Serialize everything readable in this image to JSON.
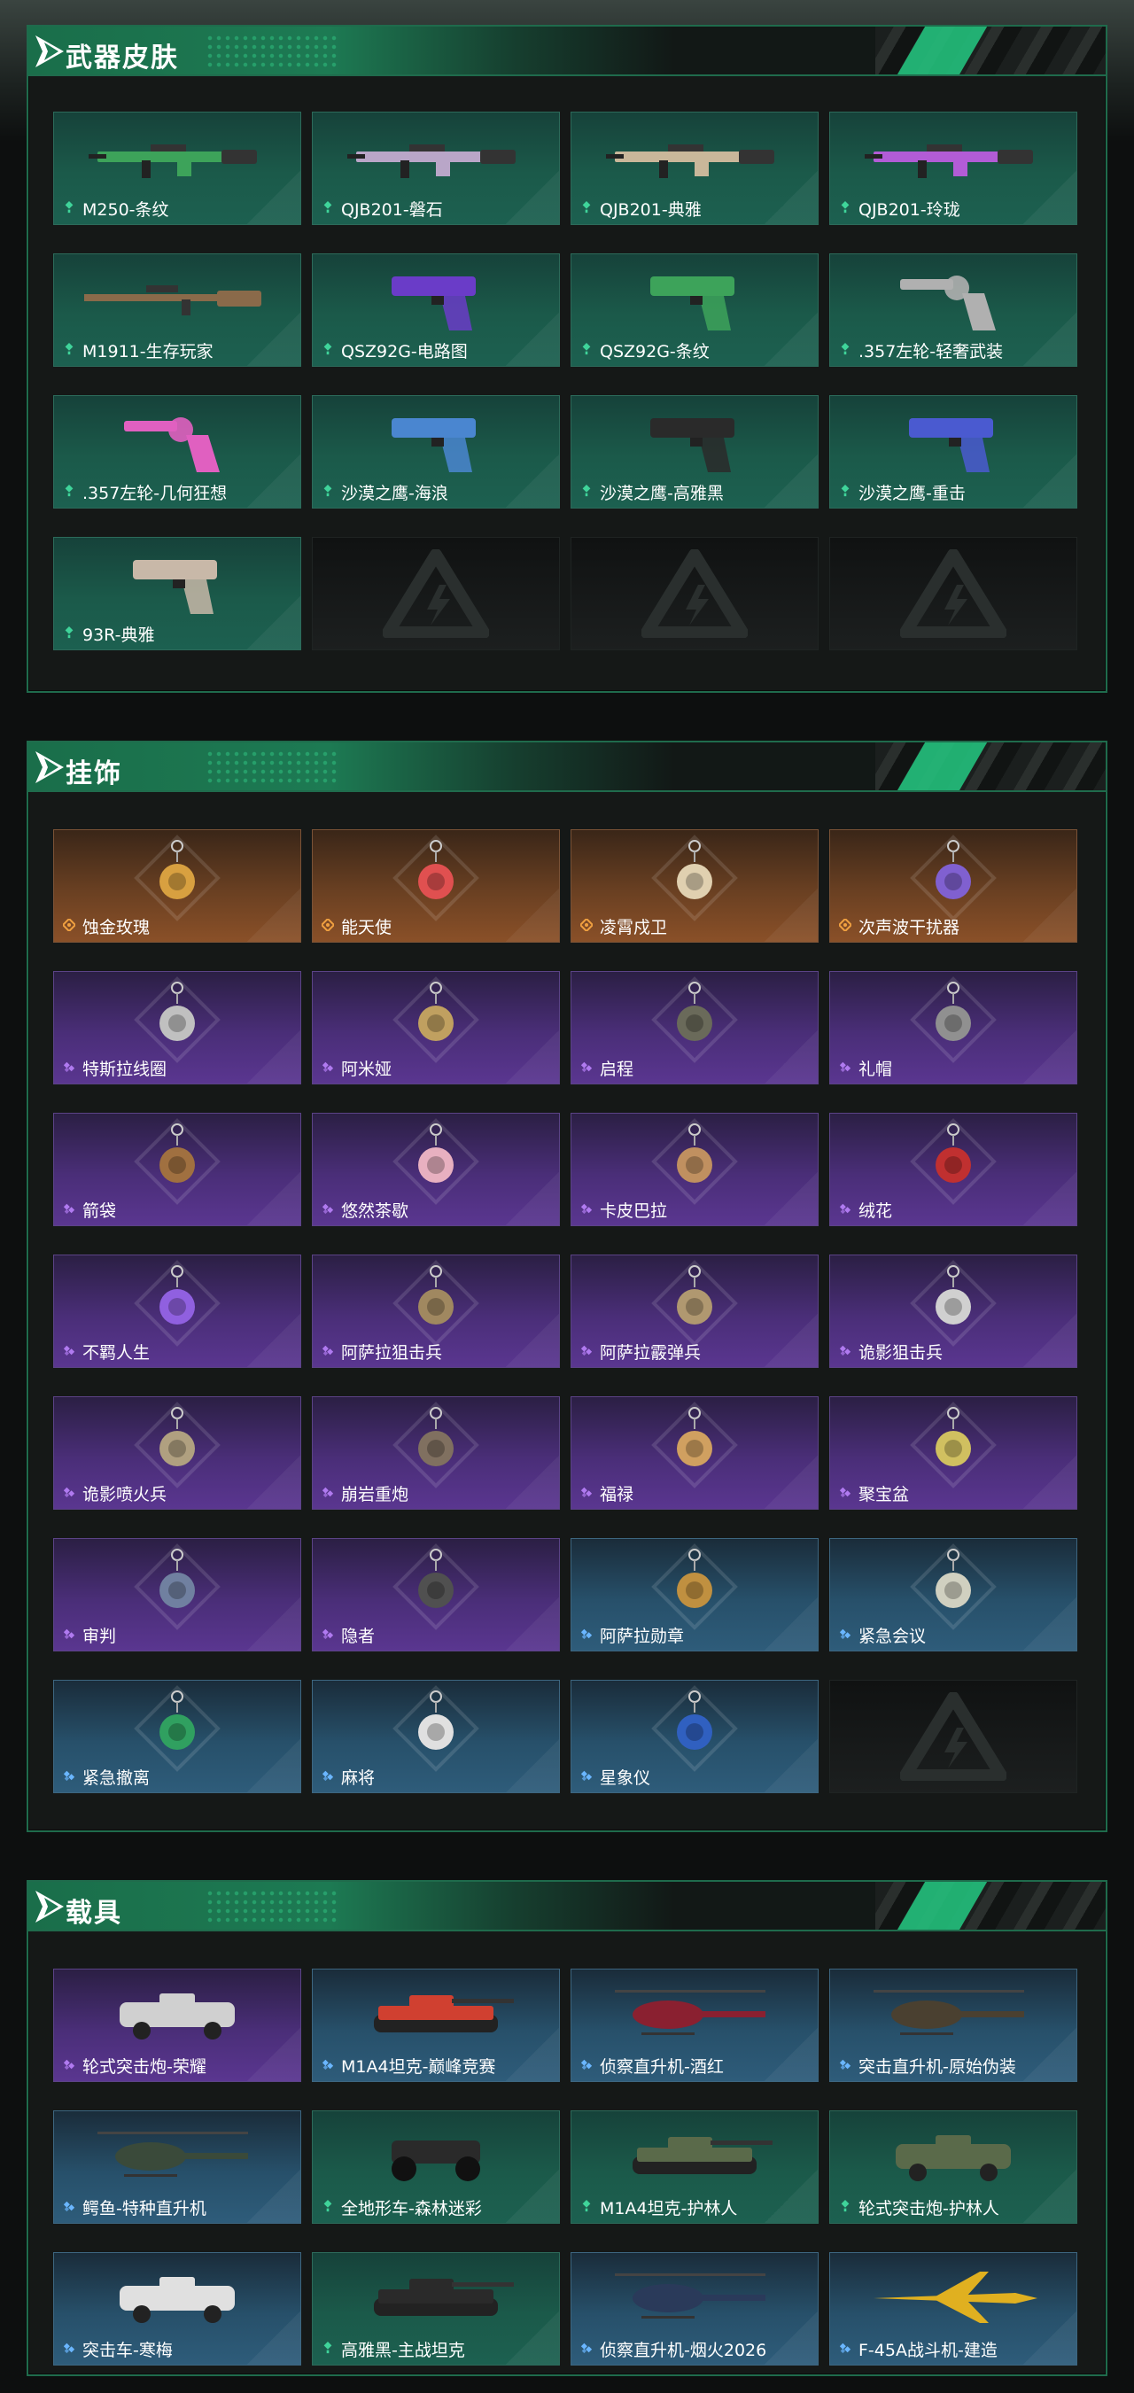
{
  "sections": [
    {
      "title": "武器皮肤",
      "items": [
        {
          "name": "M250-条纹",
          "rarity": "green",
          "icon": "rifle-icon",
          "color": "#3da35a"
        },
        {
          "name": "QJB201-磐石",
          "rarity": "green",
          "icon": "rifle-icon",
          "color": "#b9a6c8"
        },
        {
          "name": "QJB201-典雅",
          "rarity": "green",
          "icon": "rifle-icon",
          "color": "#c9b79a"
        },
        {
          "name": "QJB201-玲珑",
          "rarity": "green",
          "icon": "rifle-icon",
          "color": "#b25cd6"
        },
        {
          "name": "M1911-生存玩家",
          "rarity": "green",
          "icon": "sniper-icon",
          "color": "#8a6a4a"
        },
        {
          "name": "QSZ92G-电路图",
          "rarity": "green",
          "icon": "pistol-icon",
          "color": "#6a3cc8"
        },
        {
          "name": "QSZ92G-条纹",
          "rarity": "green",
          "icon": "pistol-icon",
          "color": "#3da35a"
        },
        {
          "name": ".357左轮-轻奢武装",
          "rarity": "green",
          "icon": "revolver-icon",
          "color": "#b0b0b0"
        },
        {
          "name": ".357左轮-几何狂想",
          "rarity": "green",
          "icon": "revolver-icon",
          "color": "#e060c0"
        },
        {
          "name": "沙漠之鹰-海浪",
          "rarity": "green",
          "icon": "pistol-icon",
          "color": "#4a86d0"
        },
        {
          "name": "沙漠之鹰-高雅黑",
          "rarity": "green",
          "icon": "pistol-icon",
          "color": "#2a2a2a"
        },
        {
          "name": "沙漠之鹰-重击",
          "rarity": "green",
          "icon": "pistol-icon",
          "color": "#4a5ad0"
        },
        {
          "name": "93R-典雅",
          "rarity": "green",
          "icon": "pistol-icon",
          "color": "#c8b8a8"
        },
        {
          "name": "",
          "rarity": "empty"
        },
        {
          "name": "",
          "rarity": "empty"
        },
        {
          "name": "",
          "rarity": "empty"
        }
      ]
    },
    {
      "title": "挂饰",
      "items": [
        {
          "name": "蚀金玫瑰",
          "rarity": "orange",
          "icon": "charm-icon",
          "color": "#d8a040"
        },
        {
          "name": "能天使",
          "rarity": "orange",
          "icon": "charm-icon",
          "color": "#e05050"
        },
        {
          "name": "凌霄戍卫",
          "rarity": "orange",
          "icon": "charm-icon",
          "color": "#e0d0b0"
        },
        {
          "name": "次声波干扰器",
          "rarity": "orange",
          "icon": "charm-icon",
          "color": "#8060d0"
        },
        {
          "name": "特斯拉线圈",
          "rarity": "purple",
          "icon": "charm-icon",
          "color": "#c0c0c0"
        },
        {
          "name": "阿米娅",
          "rarity": "purple",
          "icon": "charm-icon",
          "color": "#c0a060"
        },
        {
          "name": "启程",
          "rarity": "purple",
          "icon": "charm-icon",
          "color": "#6a6a5a"
        },
        {
          "name": "礼帽",
          "rarity": "purple",
          "icon": "charm-icon",
          "color": "#909090"
        },
        {
          "name": "箭袋",
          "rarity": "purple",
          "icon": "charm-icon",
          "color": "#a07040"
        },
        {
          "name": "悠然茶歇",
          "rarity": "purple",
          "icon": "charm-icon",
          "color": "#e8b0c0"
        },
        {
          "name": "卡皮巴拉",
          "rarity": "purple",
          "icon": "charm-icon",
          "color": "#c09060"
        },
        {
          "name": "绒花",
          "rarity": "purple",
          "icon": "charm-icon",
          "color": "#c03030"
        },
        {
          "name": "不羁人生",
          "rarity": "purple",
          "icon": "charm-icon",
          "color": "#9060e0"
        },
        {
          "name": "阿萨拉狙击兵",
          "rarity": "purple",
          "icon": "charm-icon",
          "color": "#a08860"
        },
        {
          "name": "阿萨拉霰弹兵",
          "rarity": "purple",
          "icon": "charm-icon",
          "color": "#b09870"
        },
        {
          "name": "诡影狙击兵",
          "rarity": "purple",
          "icon": "charm-icon",
          "color": "#d0d0d0"
        },
        {
          "name": "诡影喷火兵",
          "rarity": "purple",
          "icon": "charm-icon",
          "color": "#b0a080"
        },
        {
          "name": "崩岩重炮",
          "rarity": "purple",
          "icon": "charm-icon",
          "color": "#807060"
        },
        {
          "name": "福禄",
          "rarity": "purple",
          "icon": "charm-icon",
          "color": "#d0a060"
        },
        {
          "name": "聚宝盆",
          "rarity": "purple",
          "icon": "charm-icon",
          "color": "#d0c060"
        },
        {
          "name": "审判",
          "rarity": "purple",
          "icon": "charm-icon",
          "color": "#7080a0"
        },
        {
          "name": "隐者",
          "rarity": "purple",
          "icon": "charm-icon",
          "color": "#505050"
        },
        {
          "name": "阿萨拉勋章",
          "rarity": "blue",
          "icon": "charm-icon",
          "color": "#c09040"
        },
        {
          "name": "紧急会议",
          "rarity": "blue",
          "icon": "charm-icon",
          "color": "#d0d0c0"
        },
        {
          "name": "紧急撤离",
          "rarity": "blue",
          "icon": "charm-icon",
          "color": "#30a060"
        },
        {
          "name": "麻将",
          "rarity": "blue",
          "icon": "charm-icon",
          "color": "#e0e0e0"
        },
        {
          "name": "星象仪",
          "rarity": "blue",
          "icon": "charm-icon",
          "color": "#3060c0"
        },
        {
          "name": "",
          "rarity": "empty"
        }
      ]
    },
    {
      "title": "载具",
      "items": [
        {
          "name": "轮式突击炮-荣耀",
          "rarity": "purple",
          "icon": "vehicle-icon",
          "color": "#d0d0d0"
        },
        {
          "name": "M1A4坦克-巅峰竞赛",
          "rarity": "blue",
          "icon": "tank-icon",
          "color": "#d04030"
        },
        {
          "name": "侦察直升机-酒红",
          "rarity": "blue",
          "icon": "helicopter-icon",
          "color": "#8a2030"
        },
        {
          "name": "突击直升机-原始伪装",
          "rarity": "blue",
          "icon": "helicopter-icon",
          "color": "#4a4030"
        },
        {
          "name": "鳄鱼-特种直升机",
          "rarity": "blue",
          "icon": "helicopter-icon",
          "color": "#3a4a3a"
        },
        {
          "name": "全地形车-森林迷彩",
          "rarity": "green",
          "icon": "atv-icon",
          "color": "#2a2a2a"
        },
        {
          "name": "M1A4坦克-护林人",
          "rarity": "green",
          "icon": "tank-icon",
          "color": "#5a6a4a"
        },
        {
          "name": "轮式突击炮-护林人",
          "rarity": "green",
          "icon": "vehicle-icon",
          "color": "#5a6a4a"
        },
        {
          "name": "突击车-寒梅",
          "rarity": "blue",
          "icon": "vehicle-icon",
          "color": "#e0e0e0"
        },
        {
          "name": "高雅黑-主战坦克",
          "rarity": "green",
          "icon": "tank-icon",
          "color": "#2a2a2a"
        },
        {
          "name": "侦察直升机-烟火2026",
          "rarity": "blue",
          "icon": "helicopter-icon",
          "color": "#2a3a5a"
        },
        {
          "name": "F-45A战斗机-建造",
          "rarity": "blue",
          "icon": "jet-icon",
          "color": "#e0b020"
        }
      ]
    }
  ],
  "rarity_colors": {
    "green": "#3fd49a",
    "orange": "#f0a040",
    "purple": "#b07af0",
    "blue": "#6ab6ff"
  }
}
